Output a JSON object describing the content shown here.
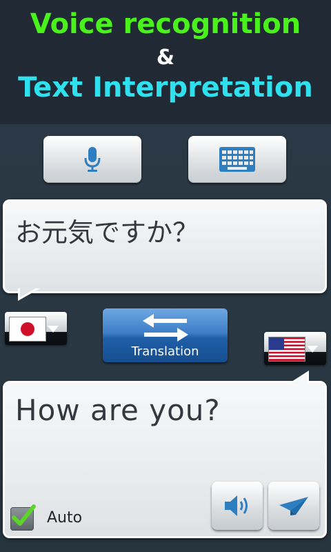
{
  "header": {
    "line1": "Voice recognition",
    "amp": "&",
    "line2": "Text Interpretation",
    "line1_color": "#49f21b",
    "line2_color": "#2fe0ef"
  },
  "toolbar": {
    "mic_icon": "microphone-icon",
    "keyboard_icon": "keyboard-icon"
  },
  "source": {
    "text": "お元気ですか？",
    "language_flag": "japan-flag-icon"
  },
  "target": {
    "text": "How are you?",
    "language_flag": "us-flag-icon"
  },
  "translate_button": {
    "label": "Translation",
    "icon": "swap-arrows-icon"
  },
  "actions": {
    "speak_icon": "speaker-icon",
    "send_icon": "paper-plane-icon"
  },
  "auto": {
    "label": "Auto",
    "checked": true
  },
  "colors": {
    "accent_blue": "#3f7fc9",
    "icon_blue": "#2e7fc1"
  }
}
